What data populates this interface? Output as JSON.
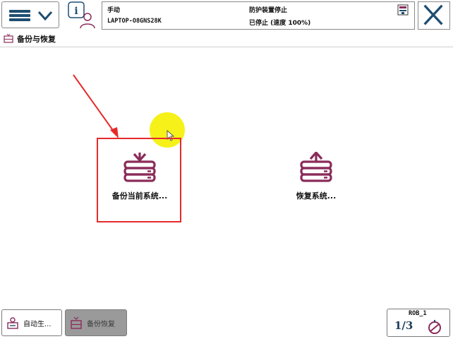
{
  "status": {
    "mode": "手动",
    "controller": "LAPTOP-O8GNS28K",
    "safety": "防护装置停止",
    "state": "已停止 (速度 100%)"
  },
  "page": {
    "title": "备份与恢复"
  },
  "actions": {
    "backup_label": "备份当前系统...",
    "restore_label": "恢复系统..."
  },
  "taskbar": {
    "auto_label": "自动生...",
    "backup_restore_label": "备份恢复"
  },
  "quickset": {
    "robot": "ROB_1",
    "fraction": "1/3"
  },
  "colors": {
    "accent": "#8a2c5a",
    "nav_blue": "#1e4e72",
    "highlight_red": "#e52a2a",
    "cursor_yellow": "#f4f000"
  },
  "icons": [
    "menu-icon",
    "chevron-down-icon",
    "info-user-icon",
    "status-icon",
    "close-icon",
    "backup-restore-icon",
    "backup-icon",
    "restore-icon",
    "auto-production-icon",
    "speed-icon",
    "pointer-icon"
  ]
}
